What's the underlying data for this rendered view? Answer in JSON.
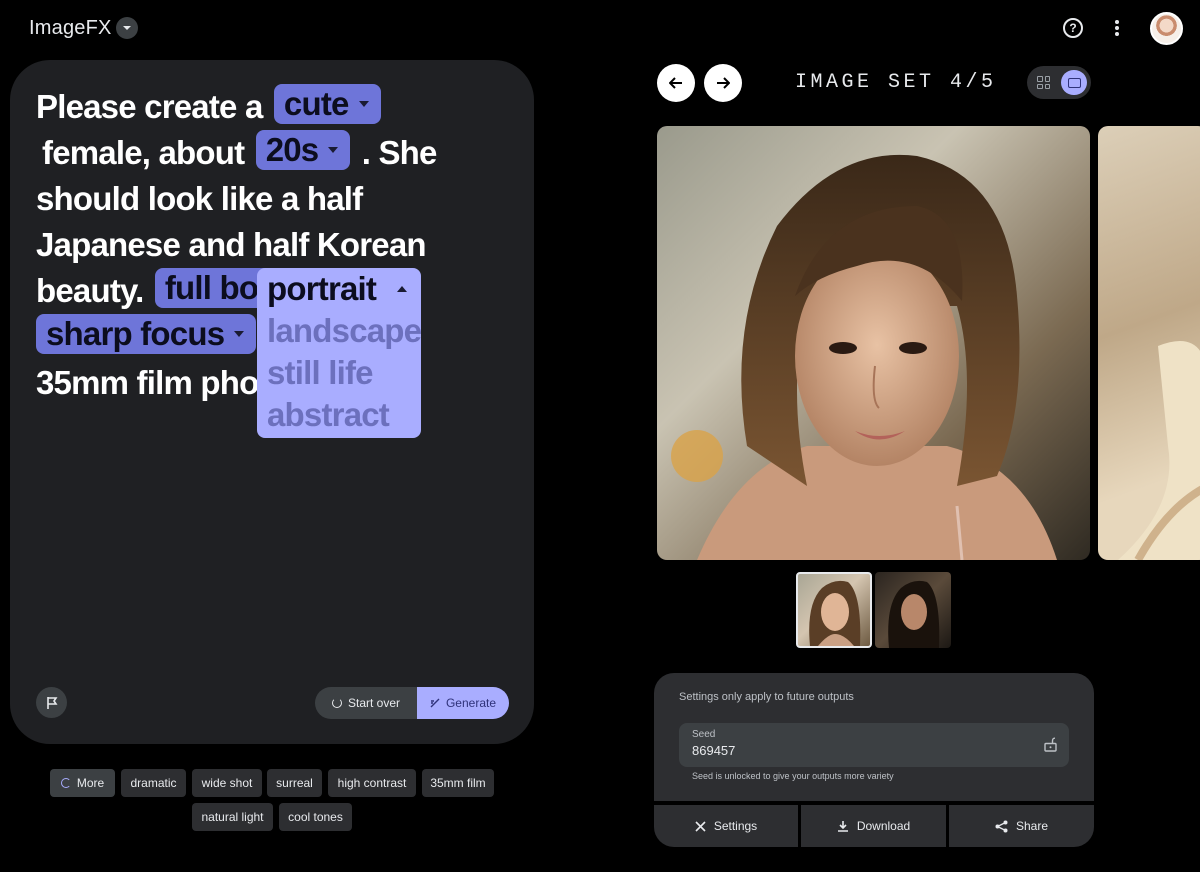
{
  "app": {
    "name": "ImageFX"
  },
  "prompt": {
    "segments": [
      {
        "type": "text",
        "value": "Please create a"
      },
      {
        "type": "chip",
        "value": "cute"
      },
      {
        "type": "text",
        "value": "female, about"
      },
      {
        "type": "chip",
        "value": "20s"
      },
      {
        "type": "text",
        "value": ". She should look like a half Japanese and half Korean beauty."
      },
      {
        "type": "chip",
        "value": "full body"
      },
      {
        "type": "text",
        "value": ","
      },
      {
        "type": "chip",
        "value": "sharp focus"
      },
      {
        "type": "chip",
        "value": "portrait"
      },
      {
        "type": "text",
        "value": "35mm film photo"
      }
    ],
    "dropdown": {
      "selected": "portrait",
      "options": [
        "landscape",
        "still life",
        "abstract"
      ]
    }
  },
  "actions": {
    "start_over": "Start over",
    "generate": "Generate"
  },
  "suggestions": {
    "more": "More",
    "items": [
      "dramatic",
      "wide shot",
      "surreal",
      "high contrast",
      "35mm film",
      "natural light",
      "cool tones"
    ]
  },
  "gallery": {
    "set_label": "IMAGE SET 4/5",
    "images": [
      {
        "alt": "Portrait of a woman with shoulder-length brown hair",
        "selected": true
      },
      {
        "alt": "Second image in set",
        "selected": false
      }
    ]
  },
  "settings": {
    "note": "Settings only apply to future outputs",
    "seed_label": "Seed",
    "seed_value": "869457",
    "seed_hint": "Seed is unlocked to give your outputs more variety"
  },
  "buttons": {
    "settings": "Settings",
    "download": "Download",
    "share": "Share"
  },
  "colors": {
    "chip": "#6e75d9",
    "chip_light": "#a9adff",
    "panel": "#1f2023"
  }
}
